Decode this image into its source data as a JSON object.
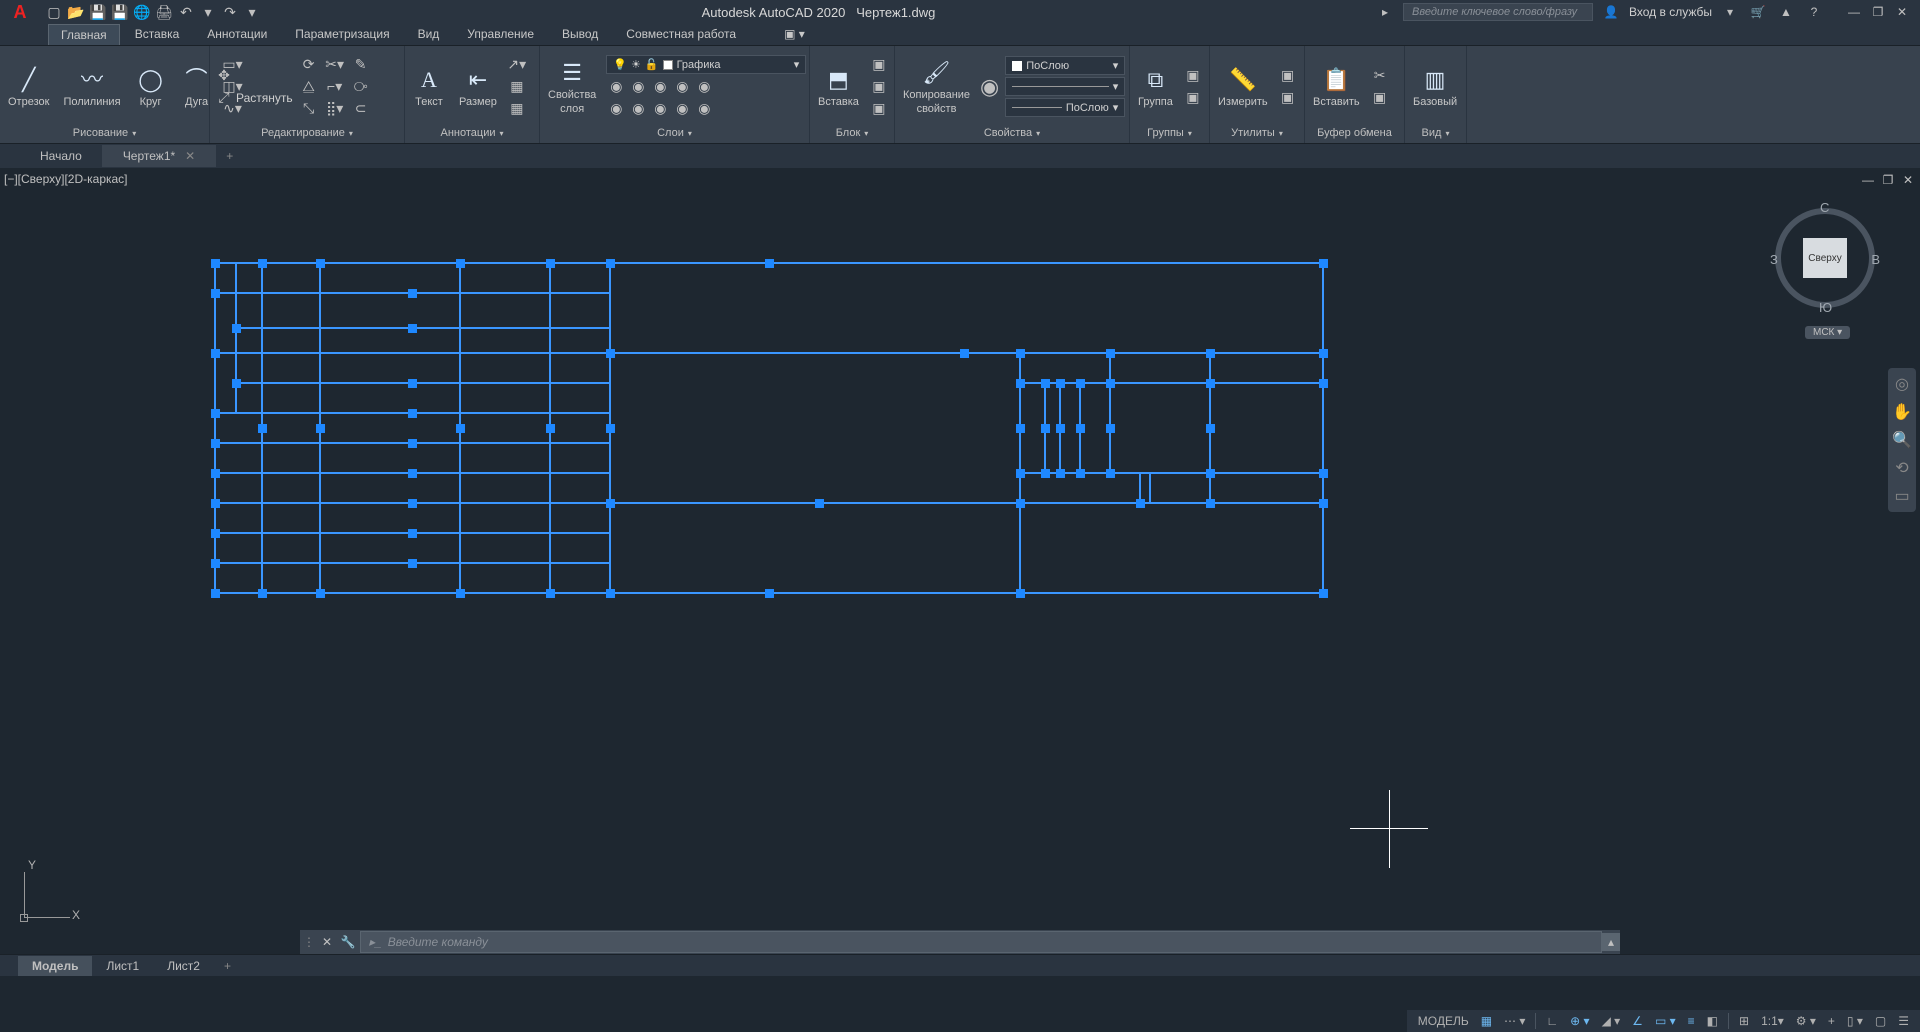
{
  "title": {
    "app": "Autodesk AutoCAD 2020",
    "file": "Чертеж1.dwg"
  },
  "search": {
    "placeholder": "Введите ключевое слово/фразу"
  },
  "signin": "Вход в службы",
  "tabs": {
    "main": "Главная",
    "insert": "Вставка",
    "annot": "Аннотации",
    "param": "Параметризация",
    "view": "Вид",
    "manage": "Управление",
    "output": "Вывод",
    "collab": "Совместная работа"
  },
  "ribbon": {
    "draw": {
      "title": "Рисование",
      "line": "Отрезок",
      "poly": "Полилиния",
      "circle": "Круг",
      "arc": "Дуга"
    },
    "edit": {
      "title": "Редактирование",
      "stretch": "Растянуть"
    },
    "annot": {
      "title": "Аннотации",
      "text": "Текст",
      "dim": "Размер"
    },
    "layers": {
      "title": "Слои",
      "props": "Свойства\nслоя",
      "current": "Графика"
    },
    "block": {
      "title": "Блок",
      "insert": "Вставка"
    },
    "props": {
      "title": "Свойства",
      "match": "Копирование\nсвойств",
      "bylayer": "ПоСлою"
    },
    "groups": {
      "title": "Группы",
      "group": "Группа"
    },
    "utils": {
      "title": "Утилиты",
      "measure": "Измерить"
    },
    "clip": {
      "title": "Буфер обмена",
      "paste": "Вставить"
    },
    "view": {
      "title": "Вид",
      "base": "Базовый"
    }
  },
  "fileTabs": {
    "start": "Начало",
    "current": "Чертеж1*"
  },
  "vp": {
    "label": "[−][Сверху][2D-каркас]"
  },
  "viewcube": {
    "face": "Сверху",
    "n": "С",
    "s": "Ю",
    "e": "В",
    "w": "З",
    "wcs": "МСК"
  },
  "ucs": {
    "x": "X",
    "y": "Y"
  },
  "cmd": {
    "placeholder": "Введите команду"
  },
  "modelTabs": {
    "model": "Модель",
    "l1": "Лист1",
    "l2": "Лист2"
  },
  "status": {
    "model": "МОДЕЛЬ",
    "scale": "1:1"
  }
}
